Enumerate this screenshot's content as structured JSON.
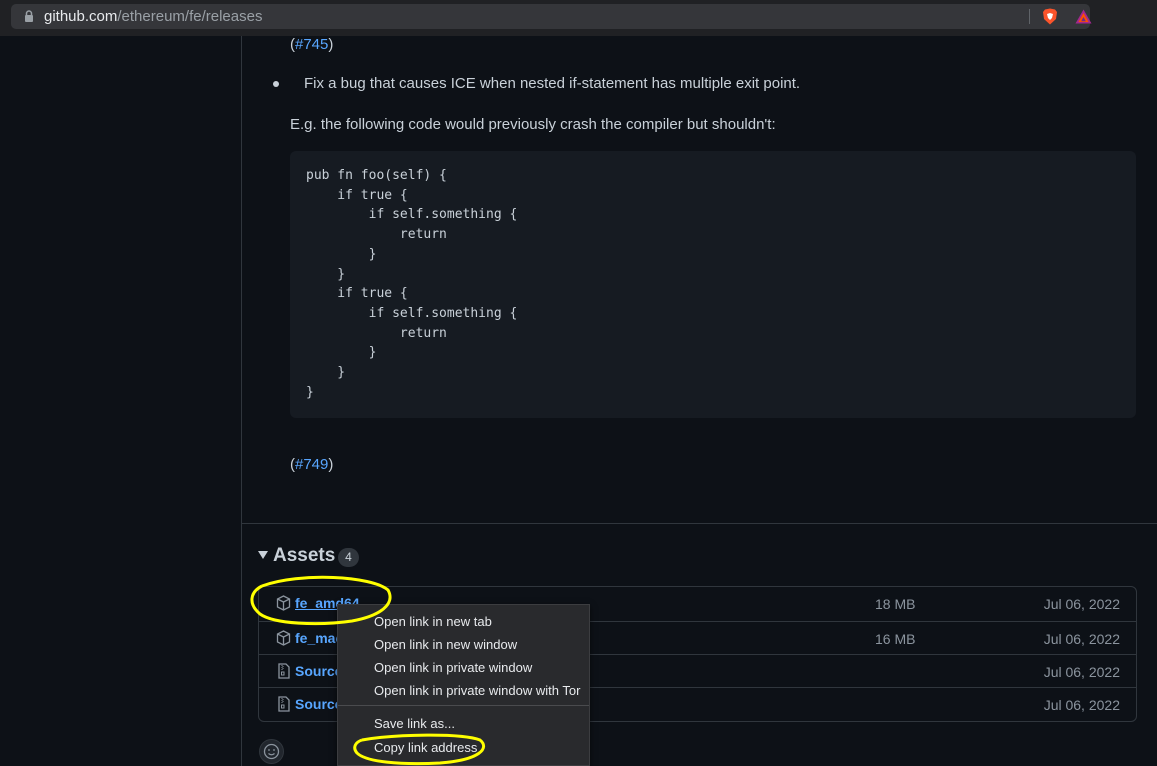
{
  "browser": {
    "url_host": "github.com",
    "url_path": "/ethereum/fe/releases"
  },
  "release_notes": {
    "ref_top": "#745",
    "bullet_text": "Fix a bug that causes ICE when nested if-statement has multiple exit point.",
    "example_intro": "E.g. the following code would previously crash the compiler but shouldn't:",
    "code": "pub fn foo(self) {\n    if true {\n        if self.something {\n            return\n        }\n    }\n    if true {\n        if self.something {\n            return\n        }\n    }\n}",
    "ref_bottom": "#749"
  },
  "assets": {
    "title": "Assets",
    "count": "4",
    "items": [
      {
        "name": "fe_amd64",
        "size": "18 MB",
        "date": "Jul 06, 2022",
        "icon": "package-icon"
      },
      {
        "name": "fe_mac",
        "size": "16 MB",
        "date": "Jul 06, 2022",
        "icon": "package-icon"
      },
      {
        "name": "Source",
        "size": "",
        "date": "Jul 06, 2022",
        "icon": "file-zip-icon"
      },
      {
        "name": "Source",
        "size": "",
        "date": "Jul 06, 2022",
        "icon": "file-zip-icon"
      }
    ]
  },
  "context_menu": {
    "items": [
      "Open link in new tab",
      "Open link in new window",
      "Open link in private window",
      "Open link in private window with Tor",
      "Save link as...",
      "Copy link address"
    ]
  },
  "colors": {
    "page_bg": "#0d1117",
    "link": "#58a6ff",
    "annotation": "#ffff00"
  }
}
